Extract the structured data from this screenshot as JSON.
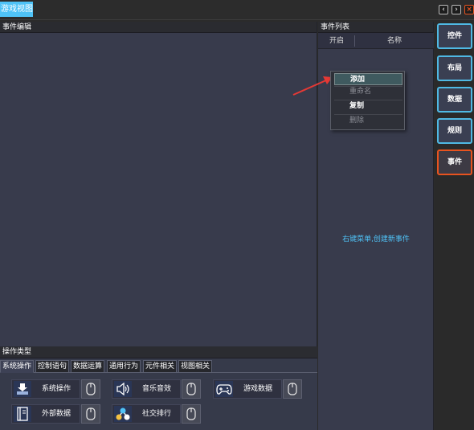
{
  "window": {
    "tab_title": "游戏视图*",
    "nav_prev": "‹",
    "nav_next": "›",
    "close": "×"
  },
  "editor": {
    "header": "事件编辑"
  },
  "operations": {
    "header": "操作类型",
    "tabs": [
      "系统操作",
      "控制语句",
      "数据运算",
      "通用行为",
      "元件相关",
      "视图相关"
    ],
    "active_tab": "系统操作",
    "items": [
      {
        "label": "系统操作",
        "icon": "monitor-download-icon"
      },
      {
        "label": "音乐音效",
        "icon": "speaker-icon"
      },
      {
        "label": "游戏数据",
        "icon": "gamepad-icon"
      },
      {
        "label": "外部数据",
        "icon": "book-icon"
      },
      {
        "label": "社交排行",
        "icon": "network-icon"
      }
    ]
  },
  "event_list": {
    "header": "事件列表",
    "columns": [
      "开启",
      "名称"
    ],
    "hint": "右键菜单,创建新事件"
  },
  "context_menu": {
    "items": [
      {
        "label": "添加",
        "enabled": true,
        "highlighted": true
      },
      {
        "label": "重命名",
        "enabled": false
      },
      {
        "label": "复制",
        "enabled": true
      },
      {
        "label": "删除",
        "enabled": false
      }
    ]
  },
  "sidebar": {
    "buttons": [
      "控件",
      "布局",
      "数据",
      "规则",
      "事件"
    ],
    "active": "事件"
  },
  "colors": {
    "accent_blue": "#4fc3f7",
    "active_orange": "#e8531f",
    "panel_bg": "#383b4c"
  }
}
